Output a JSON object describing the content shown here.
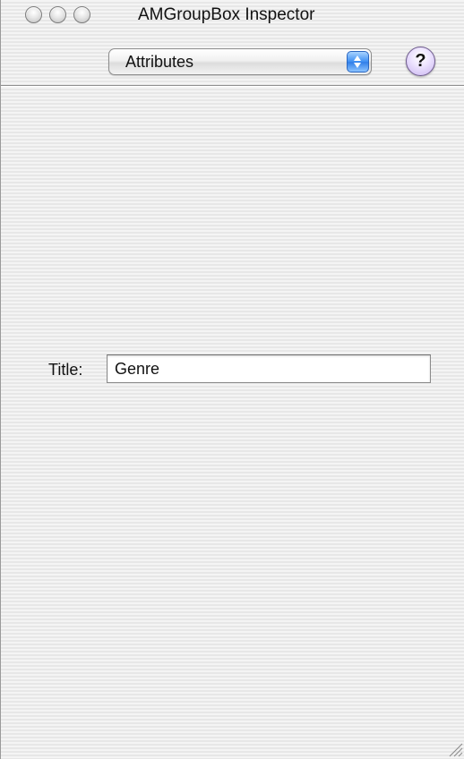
{
  "window": {
    "title": "AMGroupBox Inspector"
  },
  "toolbar": {
    "popup_selected": "Attributes",
    "help_label": "?"
  },
  "form": {
    "title_label": "Title:",
    "title_value": "Genre"
  },
  "colors": {
    "popup_arrow_accent": "#3d8ff3",
    "help_button_tint": "#c9b4f0",
    "window_background": "#ededed"
  },
  "icons": {
    "close": "close-icon",
    "minimize": "minimize-icon",
    "zoom": "zoom-icon",
    "popup_arrows": "chevron-updown-icon",
    "help": "help-icon",
    "resize": "resize-grip-icon"
  }
}
